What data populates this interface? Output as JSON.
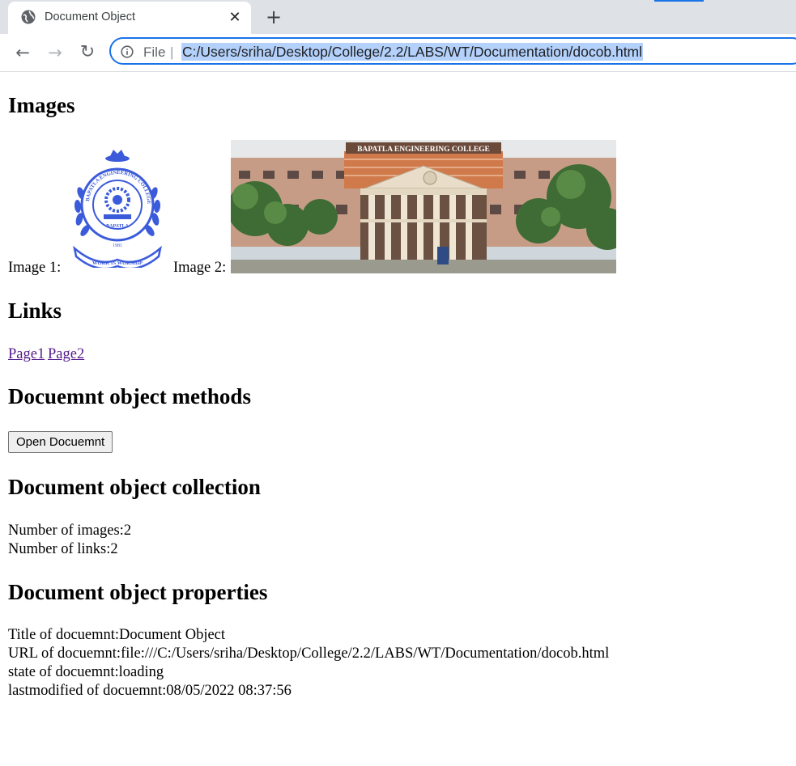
{
  "browser": {
    "tab_title": "Document Object",
    "address": {
      "scheme_label": "File",
      "url": "C:/Users/sriha/Desktop/College/2.2/LABS/WT/Documentation/docob.html"
    }
  },
  "page": {
    "images_section": {
      "heading": "Images",
      "image1_label": "Image 1:",
      "image2_label": "Image 2:",
      "logo_text": {
        "top": "BAPATLA ENGINEERING COLLEGE",
        "city": "BAPATLA",
        "year": "1981",
        "motto": "WORK IS WORSHIP"
      },
      "photo_sign": "BAPATLA ENGINEERING COLLEGE"
    },
    "links_section": {
      "heading": "Links",
      "links": [
        "Page1",
        "Page2"
      ]
    },
    "methods_section": {
      "heading": "Docuemnt object methods",
      "button_label": "Open Docuemnt"
    },
    "collection_section": {
      "heading": "Document object collection",
      "lines": [
        "Number of images:2",
        "Number of links:2"
      ]
    },
    "properties_section": {
      "heading": "Document object properties",
      "lines": [
        "Title of docuemnt:Document Object",
        "URL of docuemnt:file:///C:/Users/sriha/Desktop/College/2.2/LABS/WT/Documentation/docob.html",
        "state of docuemnt:loading",
        "lastmodified of docuemnt:08/05/2022 08:37:56"
      ]
    }
  },
  "colors": {
    "accent": "#1a73e8",
    "url_selection": "#b3d1fb",
    "visited_link": "#551a8b",
    "logo_blue": "#3b5bdb"
  },
  "icons": {
    "tab": "globe-icon",
    "close": "close-icon",
    "new_tab": "plus-icon",
    "back": "back-arrow-icon",
    "forward": "forward-arrow-icon",
    "reload": "reload-icon",
    "site_info": "info-icon"
  }
}
